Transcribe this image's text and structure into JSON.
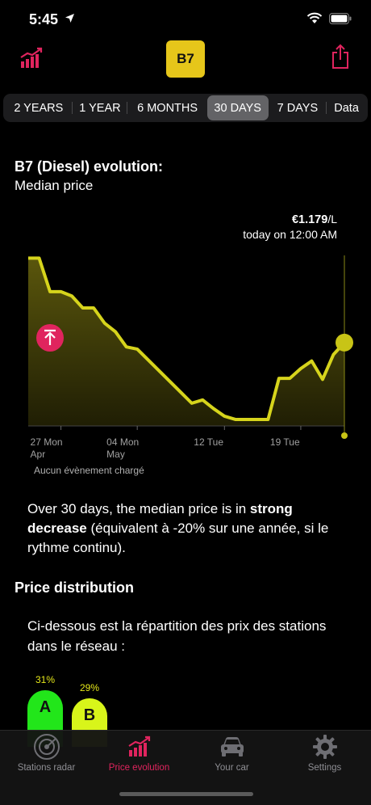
{
  "status": {
    "time": "5:45"
  },
  "header": {
    "fuel_badge": "B7"
  },
  "periods": [
    {
      "label": "2 YEARS"
    },
    {
      "label": "1 YEAR"
    },
    {
      "label": "6 MONTHS"
    },
    {
      "label": "30 DAYS",
      "active": true
    },
    {
      "label": "7 DAYS"
    },
    {
      "label": "Data"
    }
  ],
  "section": {
    "title": "B7 (Diesel) evolution:",
    "subtitle": "Median price"
  },
  "price": {
    "value": "€1.179",
    "unit": "/L",
    "when": "today on 12:00 AM"
  },
  "chart_data": {
    "type": "area",
    "x": [
      "04-24",
      "04-25",
      "04-26",
      "04-27",
      "04-28",
      "04-29",
      "04-30",
      "05-01",
      "05-02",
      "05-03",
      "05-04",
      "05-05",
      "05-06",
      "05-07",
      "05-08",
      "05-09",
      "05-10",
      "05-11",
      "05-12",
      "05-13",
      "05-14",
      "05-15",
      "05-16",
      "05-17",
      "05-18",
      "05-19",
      "05-20",
      "05-21",
      "05-22",
      "05-23"
    ],
    "values": [
      1.29,
      1.29,
      1.259,
      1.259,
      1.255,
      1.244,
      1.244,
      1.23,
      1.222,
      1.208,
      1.206,
      1.196,
      1.186,
      1.176,
      1.166,
      1.156,
      1.159,
      1.151,
      1.144,
      1.141,
      1.141,
      1.141,
      1.141,
      1.179,
      1.179,
      1.188,
      1.195,
      1.178,
      1.201,
      1.212
    ],
    "tick_labels": [
      {
        "x": "04-27",
        "line1": "27 Mon",
        "line2": "Apr"
      },
      {
        "x": "05-04",
        "line1": "04 Mon",
        "line2": "May"
      },
      {
        "x": "05-12",
        "line1": "12 Tue",
        "line2": ""
      },
      {
        "x": "05-19",
        "line1": "19 Tue",
        "line2": ""
      }
    ],
    "ylim": [
      1.135,
      1.3
    ],
    "fill_color": "#5a560c",
    "line_color": "#d6d41c",
    "grid": false
  },
  "events": {
    "text": "Aucun évènement chargé"
  },
  "summary": {
    "part1": "Over 30 days, the median price is in ",
    "bold": "strong decrease",
    "part2": " (équivalent à -20% sur une année, si le rythme continu)."
  },
  "distribution": {
    "title": "Price distribution",
    "text": "Ci-dessous est la répartition des prix des stations dans le réseau :",
    "bars": [
      {
        "letter": "A",
        "pct": "31%",
        "color": "#22e61a"
      },
      {
        "letter": "B",
        "pct": "29%",
        "color": "#d8f51a"
      }
    ]
  },
  "tabs": [
    {
      "label": "Stations radar",
      "icon": "radar-icon"
    },
    {
      "label": "Price evolution",
      "icon": "bar-chart-icon",
      "active": true
    },
    {
      "label": "Your car",
      "icon": "car-icon"
    },
    {
      "label": "Settings",
      "icon": "gear-icon"
    }
  ],
  "colors": {
    "accent": "#e0245e",
    "badge": "#e6c61a"
  }
}
